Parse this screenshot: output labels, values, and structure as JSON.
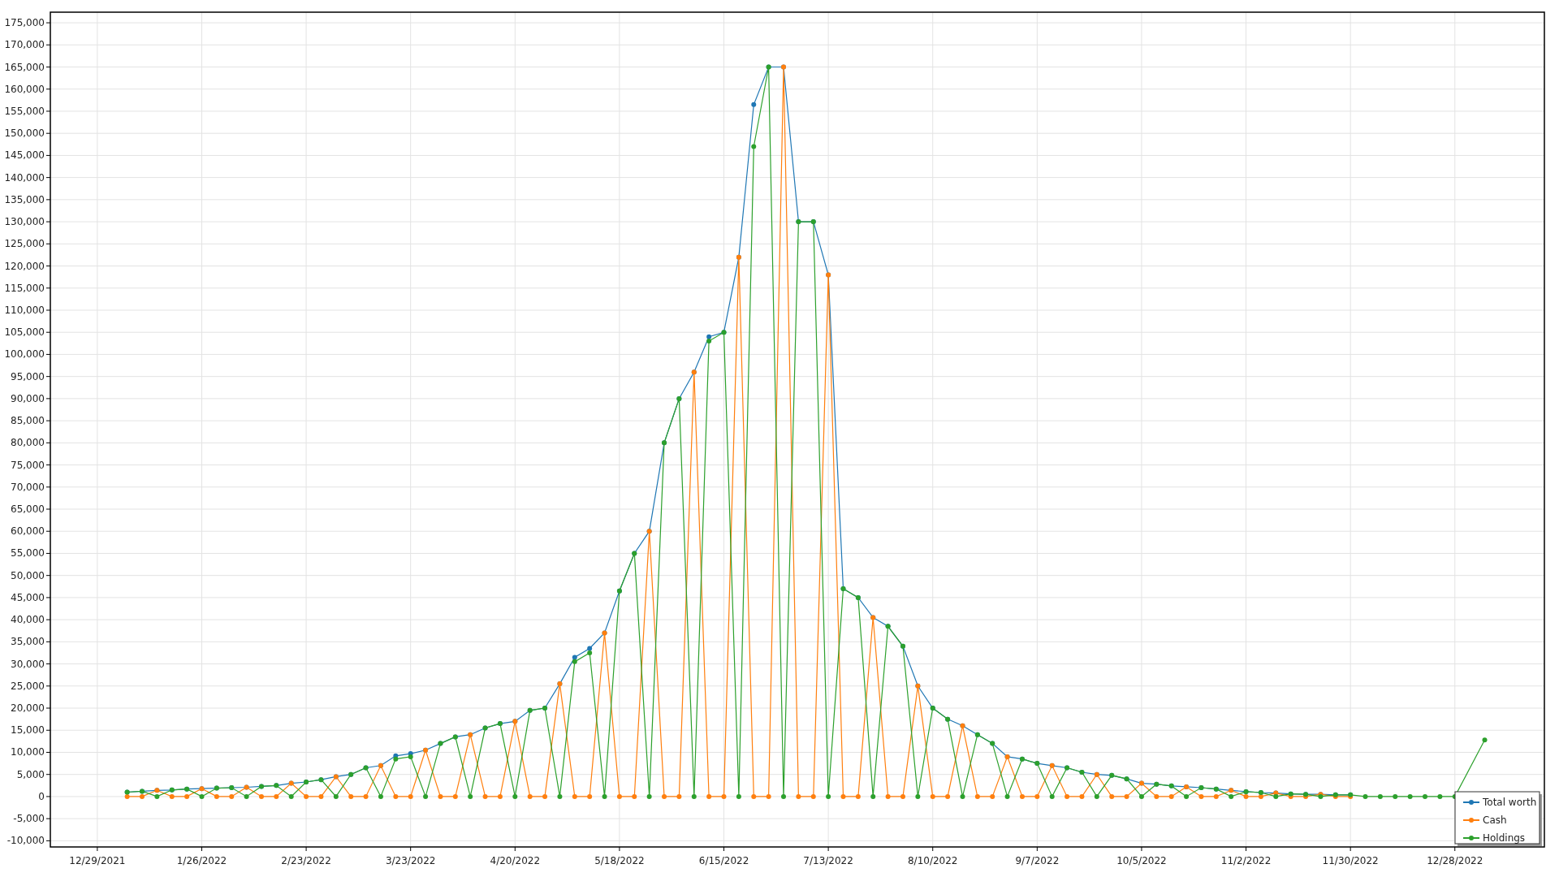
{
  "chart": {
    "chart_data": {
      "type": "line",
      "grid": true,
      "legend": true,
      "ylim": [
        -11400,
        177400
      ],
      "categories": [
        "12/29/2021",
        null,
        null,
        null,
        null,
        null,
        null,
        "1/26/2022",
        null,
        null,
        null,
        null,
        null,
        null,
        "2/23/2022",
        null,
        null,
        null,
        null,
        null,
        null,
        "3/23/2022",
        null,
        null,
        null,
        null,
        null,
        null,
        "4/20/2022",
        null,
        null,
        null,
        null,
        null,
        null,
        "5/18/2022",
        null,
        null,
        null,
        null,
        null,
        null,
        "6/15/2022",
        null,
        null,
        null,
        null,
        null,
        null,
        "7/13/2022",
        null,
        null,
        null,
        null,
        null,
        null,
        "8/10/2022",
        null,
        null,
        null,
        null,
        null,
        null,
        "9/7/2022",
        null,
        null,
        null,
        null,
        null,
        null,
        "10/5/2022",
        null,
        null,
        null,
        null,
        null,
        null,
        "11/2/2022",
        null,
        null,
        null,
        null,
        null,
        null,
        "11/30/2022",
        null,
        null,
        null,
        null,
        null,
        null,
        "12/28/2022",
        null,
        null
      ],
      "yticks": [
        {
          "value": -10000,
          "label": "-10,000"
        },
        {
          "value": -5000,
          "label": "-5,000"
        },
        {
          "value": 0,
          "label": "0"
        },
        {
          "value": 5000,
          "label": "5,000"
        },
        {
          "value": 10000,
          "label": "10,000"
        },
        {
          "value": 15000,
          "label": "15,000"
        },
        {
          "value": 20000,
          "label": "20,000"
        },
        {
          "value": 25000,
          "label": "25,000"
        },
        {
          "value": 30000,
          "label": "30,000"
        },
        {
          "value": 35000,
          "label": "35,000"
        },
        {
          "value": 40000,
          "label": "40,000"
        },
        {
          "value": 45000,
          "label": "45,000"
        },
        {
          "value": 50000,
          "label": "50,000"
        },
        {
          "value": 55000,
          "label": "55,000"
        },
        {
          "value": 60000,
          "label": "60,000"
        },
        {
          "value": 65000,
          "label": "65,000"
        },
        {
          "value": 70000,
          "label": "70,000"
        },
        {
          "value": 75000,
          "label": "75,000"
        },
        {
          "value": 80000,
          "label": "80,000"
        },
        {
          "value": 85000,
          "label": "85,000"
        },
        {
          "value": 90000,
          "label": "90,000"
        },
        {
          "value": 95000,
          "label": "95,000"
        },
        {
          "value": 100000,
          "label": "100,000"
        },
        {
          "value": 105000,
          "label": "105,000"
        },
        {
          "value": 110000,
          "label": "110,000"
        },
        {
          "value": 115000,
          "label": "115,000"
        },
        {
          "value": 120000,
          "label": "120,000"
        },
        {
          "value": 125000,
          "label": "125,000"
        },
        {
          "value": 130000,
          "label": "130,000"
        },
        {
          "value": 135000,
          "label": "135,000"
        },
        {
          "value": 140000,
          "label": "140,000"
        },
        {
          "value": 145000,
          "label": "145,000"
        },
        {
          "value": 150000,
          "label": "150,000"
        },
        {
          "value": 155000,
          "label": "155,000"
        },
        {
          "value": 160000,
          "label": "160,000"
        },
        {
          "value": 165000,
          "label": "165,000"
        },
        {
          "value": 170000,
          "label": "170,000"
        },
        {
          "value": 175000,
          "label": "175,000"
        }
      ],
      "series": [
        {
          "name": "Total worth",
          "color": "#1f77b4",
          "marker": "circle",
          "values": [
            null,
            null,
            1000,
            1200,
            1400,
            1500,
            1700,
            1800,
            1900,
            2000,
            2100,
            2300,
            2500,
            3000,
            3300,
            3800,
            4500,
            5000,
            6500,
            7000,
            9200,
            9700,
            10500,
            12000,
            13500,
            14000,
            15500,
            16500,
            17000,
            19500,
            20000,
            25500,
            31500,
            33500,
            37000,
            46500,
            55000,
            60000,
            80000,
            90000,
            96000,
            104000,
            105000,
            122000,
            156500,
            165000,
            165000,
            130000,
            130000,
            118000,
            47000,
            45000,
            40500,
            38500,
            34000,
            25000,
            20000,
            17500,
            16000,
            14000,
            12000,
            9000,
            8500,
            7500,
            7000,
            6500,
            5500,
            5000,
            4800,
            4000,
            3000,
            2800,
            2400,
            2200,
            2000,
            1700,
            1400,
            1100,
            900,
            800,
            600,
            500,
            500,
            400,
            400,
            null,
            null,
            null,
            null,
            null,
            null,
            null,
            null,
            null
          ]
        },
        {
          "name": "Cash",
          "color": "#ff7f0e",
          "marker": "circle",
          "values": [
            null,
            null,
            0,
            0,
            1400,
            0,
            0,
            1800,
            0,
            0,
            2100,
            0,
            0,
            3000,
            0,
            0,
            4500,
            0,
            0,
            7000,
            0,
            0,
            10500,
            0,
            0,
            14000,
            0,
            0,
            17000,
            0,
            0,
            25500,
            0,
            0,
            37000,
            0,
            0,
            60000,
            0,
            0,
            96000,
            0,
            0,
            122000,
            0,
            0,
            165000,
            0,
            0,
            118000,
            0,
            0,
            40500,
            0,
            0,
            25000,
            0,
            0,
            16000,
            0,
            0,
            9000,
            0,
            0,
            7000,
            0,
            0,
            5000,
            0,
            0,
            3000,
            0,
            0,
            2200,
            0,
            0,
            1400,
            0,
            0,
            800,
            0,
            0,
            500,
            0,
            0,
            null,
            null,
            null,
            null,
            null,
            null,
            null,
            null,
            null
          ]
        },
        {
          "name": "Holdings",
          "color": "#2ca02c",
          "marker": "circle",
          "values": [
            null,
            null,
            1000,
            1200,
            0,
            1500,
            1700,
            0,
            1900,
            2000,
            0,
            2300,
            2500,
            0,
            3300,
            3800,
            0,
            5000,
            6500,
            0,
            8500,
            9000,
            0,
            12000,
            13500,
            0,
            15500,
            16500,
            0,
            19500,
            20000,
            0,
            30500,
            32500,
            0,
            46500,
            55000,
            0,
            80000,
            90000,
            0,
            103000,
            105000,
            0,
            147000,
            165000,
            0,
            130000,
            130000,
            0,
            47000,
            45000,
            0,
            38500,
            34000,
            0,
            20000,
            17500,
            0,
            14000,
            12000,
            0,
            8500,
            7500,
            0,
            6500,
            5500,
            0,
            4800,
            4000,
            0,
            2800,
            2400,
            0,
            2000,
            1700,
            0,
            1100,
            900,
            0,
            600,
            500,
            0,
            400,
            400,
            0,
            0,
            0,
            0,
            0,
            0,
            0,
            null,
            12800
          ]
        }
      ]
    }
  }
}
